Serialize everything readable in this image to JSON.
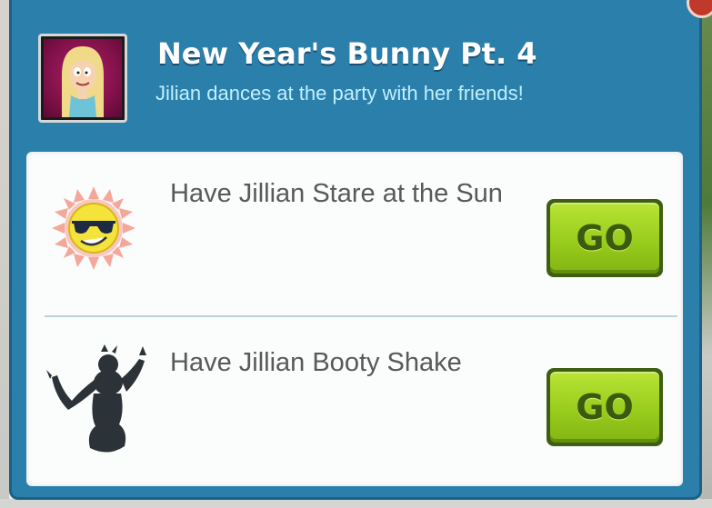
{
  "dialog": {
    "title": "New Year's Bunny Pt. 4",
    "subtitle": "Jilian dances at the party with her friends!",
    "portrait_icon": "character-portrait-icon"
  },
  "tasks": [
    {
      "label": "Have Jillian Stare at the Sun",
      "icon": "sun-with-sunglasses-icon",
      "button": "GO"
    },
    {
      "label": "Have Jillian Booty Shake",
      "icon": "dancing-silhouette-icon",
      "button": "GO"
    }
  ],
  "colors": {
    "dialog_bg": "#2b7fab",
    "title": "#ffffff",
    "subtitle": "#bff0ff",
    "go_button": "#98cc1d",
    "task_text": "#595959"
  }
}
